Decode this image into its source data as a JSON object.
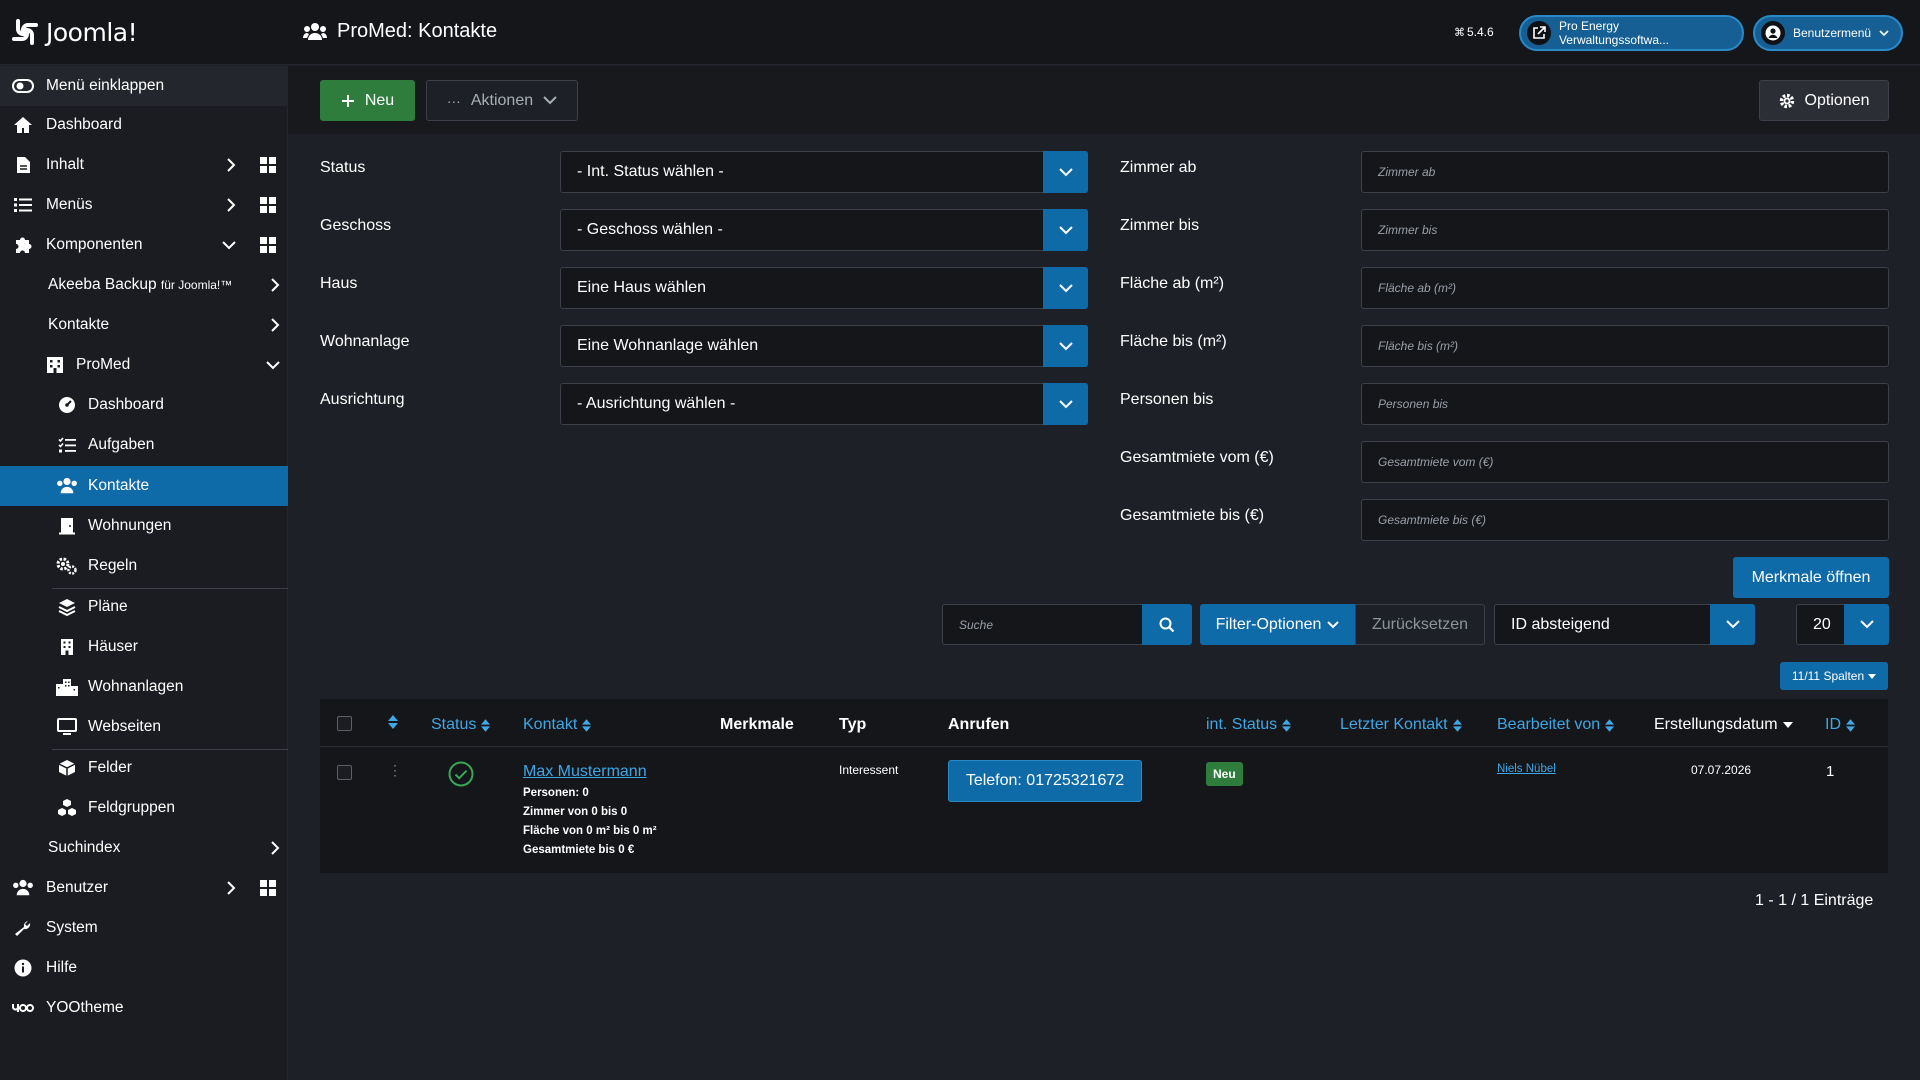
{
  "header": {
    "logo_text": "Joomla!",
    "page_title": "ProMed: Kontakte",
    "version": "5.4.6",
    "site_button": "Pro Energy Verwaltungssoftwa...",
    "user_menu": "Benutzermenü"
  },
  "sidebar": {
    "collapse": "Menü einklappen",
    "dashboard": "Dashboard",
    "content": "Inhalt",
    "menus": "Menüs",
    "components": "Komponenten",
    "akeeba_a": "Akeeba Backup ",
    "akeeba_b": "für Joomla!™",
    "contacts": "Kontakte",
    "promed": "ProMed",
    "sub": {
      "dashboard": "Dashboard",
      "tasks": "Aufgaben",
      "contacts": "Kontakte",
      "apartments": "Wohnungen",
      "rules": "Regeln",
      "plans": "Pläne",
      "houses": "Häuser",
      "complexes": "Wohnanlagen",
      "websites": "Webseiten",
      "fields": "Felder",
      "fieldgroups": "Feldgruppen"
    },
    "smartsearch": "Suchindex",
    "users": "Benutzer",
    "system": "System",
    "help": "Hilfe",
    "yootheme": "YOOtheme"
  },
  "toolbar": {
    "new": "Neu",
    "actions": "Aktionen",
    "options": "Optionen"
  },
  "filters_left": [
    {
      "label": "Status",
      "value": "- Int. Status wählen -"
    },
    {
      "label": "Geschoss",
      "value": "- Geschoss wählen -"
    },
    {
      "label": "Haus",
      "value": "Eine Haus wählen"
    },
    {
      "label": "Wohnanlage",
      "value": "Eine Wohnanlage wählen"
    },
    {
      "label": "Ausrichtung",
      "value": "- Ausrichtung wählen -"
    }
  ],
  "filters_right": [
    {
      "label": "Zimmer ab",
      "placeholder": "Zimmer ab"
    },
    {
      "label": "Zimmer bis",
      "placeholder": "Zimmer bis"
    },
    {
      "label": "Fläche ab (m²)",
      "placeholder": "Fläche ab (m²)"
    },
    {
      "label": "Fläche bis (m²)",
      "placeholder": "Fläche bis (m²)"
    },
    {
      "label": "Personen bis",
      "placeholder": "Personen bis"
    },
    {
      "label": "Gesamtmiete vom (€)",
      "placeholder": "Gesamtmiete vom (€)"
    },
    {
      "label": "Gesamtmiete bis (€)",
      "placeholder": "Gesamtmiete bis (€)"
    }
  ],
  "features_button": "Merkmale öffnen",
  "search": {
    "placeholder": "Suche",
    "filter_options": "Filter-Optionen",
    "reset": "Zurücksetzen",
    "sort": "ID absteigend",
    "limit": "20",
    "columns": "11/11 Spalten"
  },
  "table": {
    "headers": {
      "status": "Status",
      "contact": "Kontakt",
      "features": "Merkmale",
      "type": "Typ",
      "call": "Anrufen",
      "int_status": "int. Status",
      "last_contact": "Letzter Kontakt",
      "edited_by": "Bearbeitet von",
      "created": "Erstellungsdatum",
      "id": "ID"
    },
    "rows": [
      {
        "name": "Max Mustermann",
        "details": [
          "Personen: 0",
          "Zimmer von 0 bis 0",
          "Fläche von 0 m² bis 0 m²",
          "Gesamtmiete bis 0 €"
        ],
        "type": "Interessent",
        "phone": "Telefon: 01725321672",
        "int_status": "Neu",
        "edited_by": "Niels Nübel",
        "created": "07.07.2026",
        "id": "1"
      }
    ]
  },
  "pagination_info": "1 - 1 / 1 Einträge",
  "colors": {
    "accent": "#0f6aa8",
    "success": "#2f7d3c",
    "bg": "#1d2026"
  }
}
